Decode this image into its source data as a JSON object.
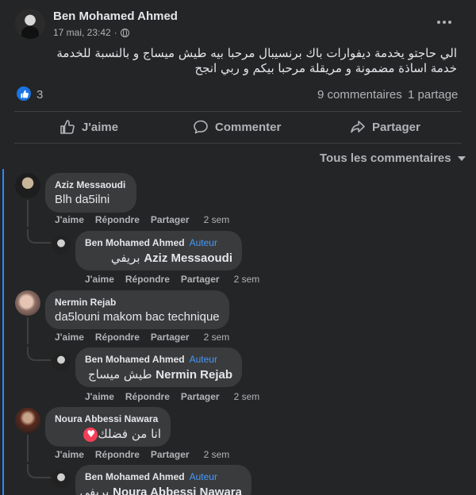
{
  "post": {
    "author": "Ben Mohamed Ahmed",
    "timestamp": "17 mai, 23:42",
    "separator": "·",
    "text": "الي حاجتو يخدمة ديفوارات باك برنسيبال مرحبا بيه طيش ميساج و بالنسبة للخدمة خدمة اساذة مضمونة و مريقلة مرحبا بيكم و ربي انجح",
    "reaction_count": "3",
    "comments_count": "9 commentaires",
    "shares_count": "1 partage"
  },
  "actions": {
    "like": "J'aime",
    "comment": "Commenter",
    "share": "Partager"
  },
  "sort": {
    "label": "Tous les commentaires"
  },
  "comment_actions": {
    "like": "J'aime",
    "reply": "Répondre",
    "share": "Partager"
  },
  "comments": [
    {
      "name": "Aziz Messaoudi",
      "text": "Blh da5ilni",
      "time": "2 sem"
    },
    {
      "name": "Ben Mohamed Ahmed",
      "badge": "Auteur",
      "mention": "Aziz Messaoudi",
      "text": "بريفي",
      "time": "2 sem"
    },
    {
      "name": "Nermin Rejab",
      "text": "da5louni makom bac technique",
      "time": "2 sem"
    },
    {
      "name": "Ben Mohamed Ahmed",
      "badge": "Auteur",
      "mention": "Nermin Rejab",
      "text": "طيش ميساج",
      "time": "2 sem"
    },
    {
      "name": "Noura Abbessi Nawara",
      "text": "انا من فضلك",
      "time": "2 sem"
    },
    {
      "name": "Ben Mohamed Ahmed",
      "badge": "Auteur",
      "mention": "Noura Abbessi Nawara",
      "text": "بريفي",
      "time": ""
    }
  ],
  "colors": {
    "background": "#242526",
    "bubble": "#3a3b3c",
    "accent": "#2d88ff",
    "text_secondary": "#b0b3b8"
  }
}
